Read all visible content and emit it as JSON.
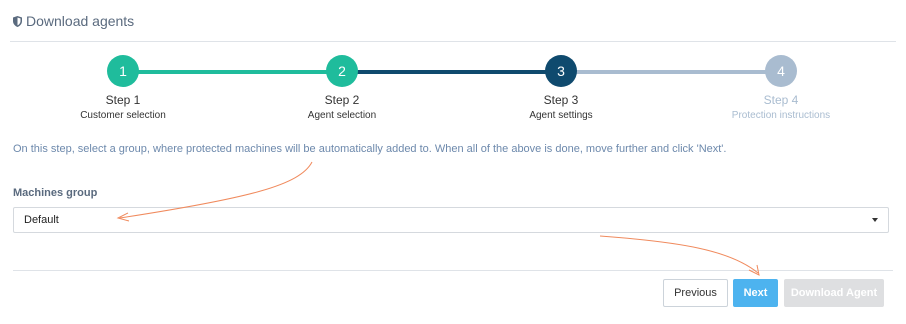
{
  "header": {
    "title": "Download agents"
  },
  "colors": {
    "completed": "#1fbc9c",
    "current": "#0f4a6e",
    "pending": "#a9bcd0",
    "accent": "#4db3ef",
    "annotation": "#f08a5d"
  },
  "steps": [
    {
      "number": "1",
      "title": "Step 1",
      "subtitle": "Customer selection",
      "state": "completed"
    },
    {
      "number": "2",
      "title": "Step 2",
      "subtitle": "Agent selection",
      "state": "completed"
    },
    {
      "number": "3",
      "title": "Step 3",
      "subtitle": "Agent settings",
      "state": "current"
    },
    {
      "number": "4",
      "title": "Step 4",
      "subtitle": "Protection instructions",
      "state": "pending"
    }
  ],
  "instruction": "On this step, select a group, where protected machines will be automatically added to. When all of the above is done, move further and click 'Next'.",
  "machines_group": {
    "label": "Machines group",
    "selected": "Default"
  },
  "buttons": {
    "previous": "Previous",
    "next": "Next",
    "download": "Download Agent"
  }
}
